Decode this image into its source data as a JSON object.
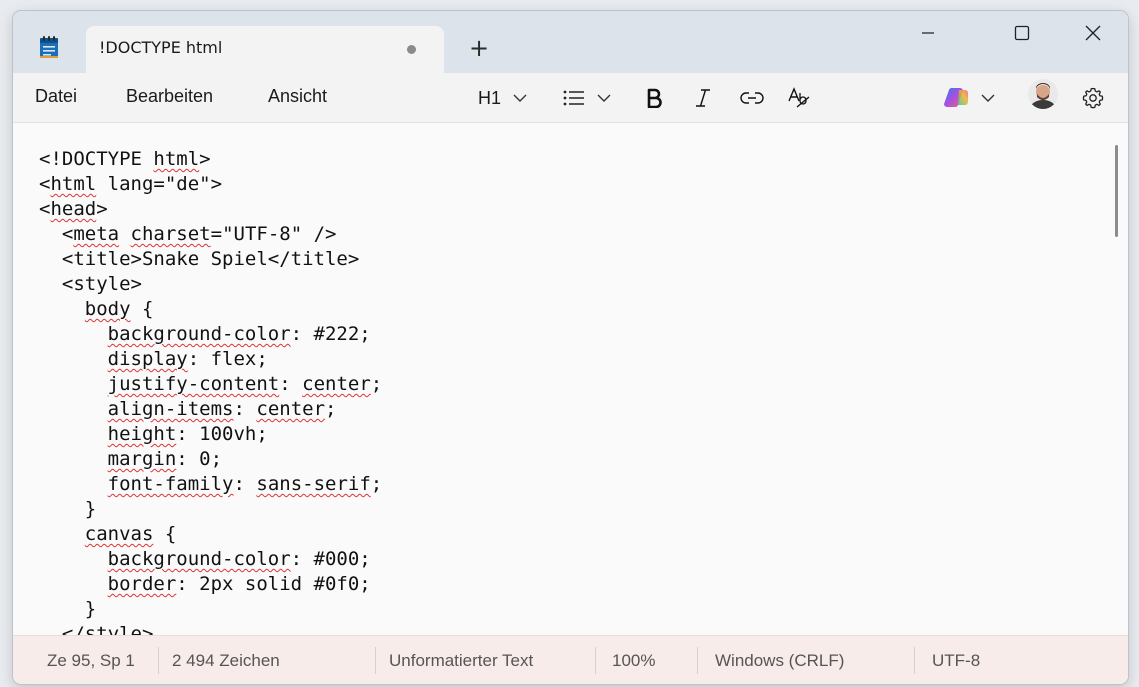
{
  "tab": {
    "title": "!DOCTYPE html",
    "new_tab": "+"
  },
  "menu": {
    "file": "Datei",
    "edit": "Bearbeiten",
    "view": "Ansicht"
  },
  "toolbar": {
    "heading": "H1"
  },
  "code_lines": [
    "<!DOCTYPE html>",
    "<html lang=\"de\">",
    "<head>",
    "  <meta charset=\"UTF-8\" />",
    "  <title>Snake Spiel</title>",
    "  <style>",
    "    body {",
    "      background-color: #222;",
    "      display: flex;",
    "      justify-content: center;",
    "      align-items: center;",
    "      height: 100vh;",
    "      margin: 0;",
    "      font-family: sans-serif;",
    "    }",
    "    canvas {",
    "      background-color: #000;",
    "      border: 2px solid #0f0;",
    "    }",
    "  </style>"
  ],
  "status": {
    "position": "Ze 95, Sp 1",
    "chars": "2 494 Zeichen",
    "format": "Unformatierter Text",
    "zoom": "100%",
    "line_ending": "Windows (CRLF)",
    "encoding": "UTF-8"
  },
  "colors": {
    "titlebar": "#dde3ea",
    "statusbar": "#f7ecea",
    "spellcheck": "#d33"
  }
}
